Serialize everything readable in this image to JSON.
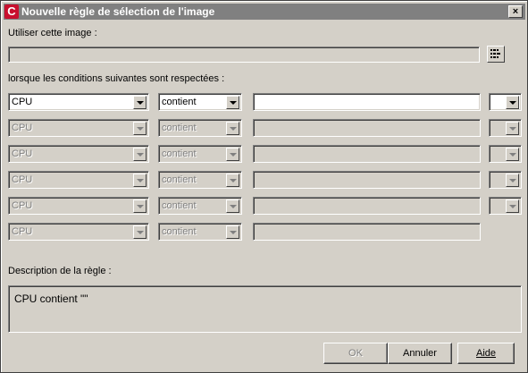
{
  "window": {
    "title": "Nouvelle règle de sélection de l'image",
    "icon": "app-logo-icon",
    "close_label": "×"
  },
  "image_label": "Utiliser cette image :",
  "image_path": "",
  "browse_icon": "browse-list-icon",
  "conditions_label": "lorsque les conditions suivantes sont respectées :",
  "rows": [
    {
      "field": "CPU",
      "operator": "contient",
      "value": "",
      "connector": "",
      "enabled": true
    },
    {
      "field": "CPU",
      "operator": "contient",
      "value": "",
      "connector": "",
      "enabled": false
    },
    {
      "field": "CPU",
      "operator": "contient",
      "value": "",
      "connector": "",
      "enabled": false
    },
    {
      "field": "CPU",
      "operator": "contient",
      "value": "",
      "connector": "",
      "enabled": false
    },
    {
      "field": "CPU",
      "operator": "contient",
      "value": "",
      "connector": "",
      "enabled": false
    },
    {
      "field": "CPU",
      "operator": "contient",
      "value": "",
      "enabled": false
    }
  ],
  "description_label": "Description de la règle :",
  "description_text": "CPU contient \"\"",
  "buttons": {
    "ok": "OK",
    "cancel": "Annuler",
    "help": "Aide"
  },
  "colors": {
    "dialog_bg": "#d4d0c8",
    "titlebar_bg": "#808080",
    "app_icon_red": "#c8102e"
  }
}
